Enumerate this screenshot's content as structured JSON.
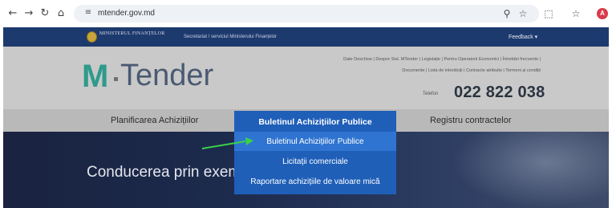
{
  "browser": {
    "url": "mtender.gov.md",
    "icons": [
      "back-icon",
      "forward-icon",
      "reload-icon",
      "home-icon",
      "site-settings-icon",
      "zoom-icon",
      "star-icon",
      "extensions-icon",
      "bookmarks-icon"
    ],
    "avatar_letter": "A"
  },
  "site": {
    "ministry": "MINISTERUL FINANȚELOR",
    "ministry_sub": "Secretariat / serviciul Ministerului Finanțelor",
    "feedback": "Feedback ▾",
    "logo_m": "M",
    "logo_tender": "Tender",
    "toplinks_row1": "Date Deschise | Despre Sist. MTender | Legislație | Pentru Operatorii Economici | Întrebări frecvente |",
    "toplinks_row2": "Documente | Lista de interdicții | Contracte atribuite | Termeni și condiții",
    "phone_label": "Telefon",
    "phone": "022 822 038",
    "menu": {
      "planning": "Planificarea Achizițiilor",
      "registry": "Registru contractelor"
    },
    "hero_text": "Conducerea prin exem",
    "dropdown": {
      "header": "Buletinul Achizițiilor Publice",
      "items": [
        "Buletinul Achizițiilor Publice",
        "Licitații comerciale",
        "Raportare achizițiile de valoare mică"
      ]
    }
  },
  "colors": {
    "dropdown_bg": "#1f5fb8",
    "dropdown_selected": "#2f74d0",
    "arrow": "#3bd14a",
    "logo_accent": "#2e9a8c"
  }
}
